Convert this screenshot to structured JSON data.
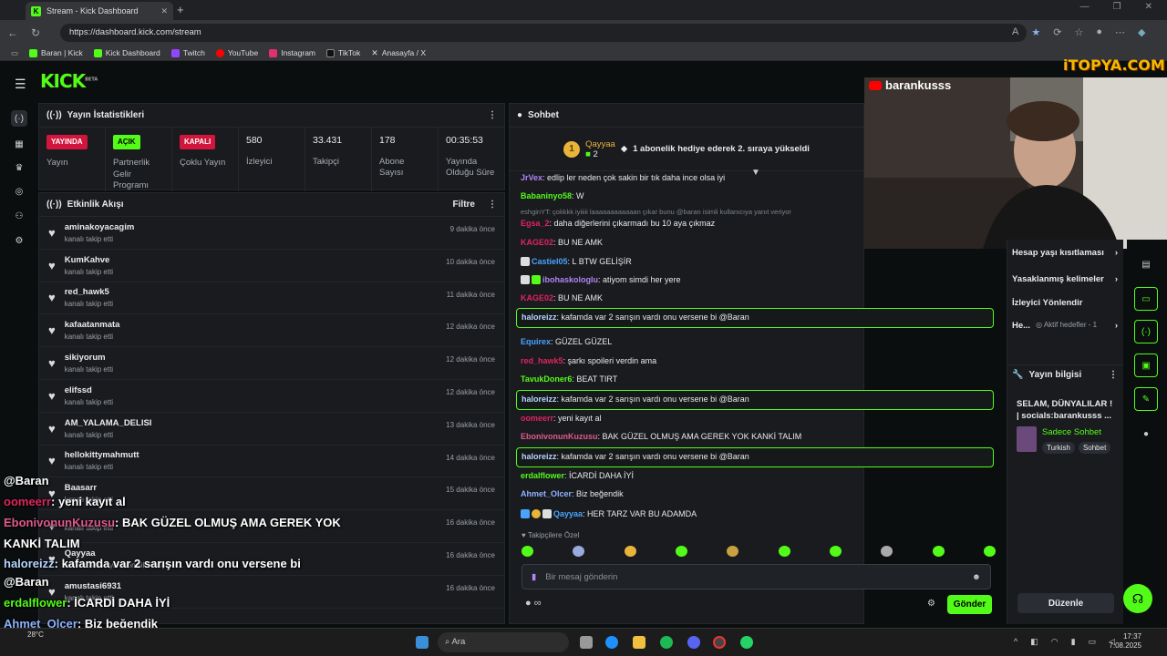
{
  "browser": {
    "tab_title": "Stream - Kick Dashboard",
    "url": "https://dashboard.kick.com/stream",
    "bookmarks": [
      "Baran | Kick",
      "Kick Dashboard",
      "Twitch",
      "YouTube",
      "Instagram",
      "TikTok",
      "Anasayfa / X"
    ]
  },
  "brand": {
    "logo": "KICK",
    "beta": "BETA",
    "watermark": "iTOPYA.COM",
    "accent": "#53fc18"
  },
  "stats": {
    "title": "Yayın İstatistikleri",
    "items": [
      {
        "badge": "YAYINDA",
        "label": "Yayın"
      },
      {
        "badge": "AÇIK",
        "label": "Partnerlik Gelir Programı"
      },
      {
        "badge": "KAPALI",
        "label": "Çoklu Yayın"
      },
      {
        "value": "580",
        "label": "İzleyici"
      },
      {
        "value": "33.431",
        "label": "Takipçi"
      },
      {
        "value": "178",
        "label": "Abone Sayısı"
      },
      {
        "value": "00:35:53",
        "label": "Yayında Olduğu Süre"
      }
    ]
  },
  "activity": {
    "title": "Etkinlik Akışı",
    "filter": "Filtre",
    "items": [
      {
        "name": "aminakoyacagim",
        "sub": "kanalı takip etti",
        "time": "9 dakika önce"
      },
      {
        "name": "KumKahve",
        "sub": "kanalı takip etti",
        "time": "10 dakika önce"
      },
      {
        "name": "red_hawk5",
        "sub": "kanalı takip etti",
        "time": "11 dakika önce"
      },
      {
        "name": "kafaatanmata",
        "sub": "kanalı takip etti",
        "time": "12 dakika önce"
      },
      {
        "name": "sikiyorum",
        "sub": "kanalı takip etti",
        "time": "12 dakika önce"
      },
      {
        "name": "elifssd",
        "sub": "kanalı takip etti",
        "time": "12 dakika önce"
      },
      {
        "name": "AM_YALAMA_DELISI",
        "sub": "kanalı takip etti",
        "time": "13 dakika önce"
      },
      {
        "name": "hellokittymahmutt",
        "sub": "kanalı takip etti",
        "time": "14 dakika önce"
      },
      {
        "name": "Baasarr",
        "sub": "kanalı takip etti",
        "time": "15 dakika önce"
      },
      {
        "name": "",
        "sub": "kanalı takip etti",
        "time": "16 dakika önce"
      },
      {
        "name": "Qayyaa",
        "sub": "isimli kullanıcıya abonelik hediye etti.",
        "time": "16 dakika önce"
      },
      {
        "name": "amustasi6931",
        "sub": "kanalı takip etti",
        "time": "16 dakika önce"
      }
    ]
  },
  "chat": {
    "title": "Sohbet",
    "pinned": {
      "user": "Qayyaa",
      "count": "2",
      "text": "1 abonelik hediye ederek 2. sıraya yükseldi"
    },
    "messages": [
      {
        "user": "JrVex",
        "color": "#b085f5",
        "text": "edlip ler neden çok sakin bir tık daha ince olsa iyi"
      },
      {
        "user": "Babaninyo58",
        "color": "#53fc18",
        "text": "W"
      },
      {
        "reply": "eshginYT: çokkkk iyiiiii laaaaaaaaaaaan çıkar bunu @baran isimli kullanıcıya yanıt veriyor",
        "user": "Egsa_2",
        "color": "#e0245e",
        "text": "daha diğerlerini çıkarmadı bu 10 aya çıkmaz"
      },
      {
        "user": "KAGE02",
        "color": "#e0245e",
        "text": "BU NE AMK"
      },
      {
        "user": "Castiel05",
        "color": "#4aa3ff",
        "text": "L BTW GELİŞİR"
      },
      {
        "user": "ibohaskologlu",
        "color": "#b085f5",
        "text": "atiyom simdi her yere"
      },
      {
        "user": "KAGE02",
        "color": "#e0245e",
        "text": "BU NE AMK"
      },
      {
        "user": "haloreizz",
        "color": "#b8d4ff",
        "text": "kafamda var 2 sarışın vardı onu versene bi @Baran",
        "highlight": true
      },
      {
        "user": "Equirex",
        "color": "#4aa3ff",
        "text": "GÜZEL GÜZEL"
      },
      {
        "user": "red_hawk5",
        "color": "#e0245e",
        "text": "şarkı spoileri verdin ama"
      },
      {
        "user": "TavukDoner6",
        "color": "#53fc18",
        "text": "BEAT TIRT"
      },
      {
        "user": "haloreizz",
        "color": "#b8d4ff",
        "text": "kafamda var 2 sarışın vardı onu versene bi @Baran",
        "highlight": true
      },
      {
        "user": "oomeerr",
        "color": "#e0245e",
        "text": "yeni kayıt al"
      },
      {
        "user": "EbonivonunKuzusu",
        "color": "#e05a8a",
        "text": "BAK GÜZEL OLMUŞ AMA GEREK YOK KANKİ TALIM"
      },
      {
        "user": "haloreizz",
        "color": "#b8d4ff",
        "text": "kafamda var 2 sarışın vardı onu versene bi @Baran",
        "highlight": true
      },
      {
        "user": "erdalflower",
        "color": "#53fc18",
        "text": "İCARDİ DAHA İYİ"
      },
      {
        "user": "Ahmet_Olcer",
        "color": "#8fb3ff",
        "text": "Biz beğendik"
      },
      {
        "user": "Qayyaa",
        "color": "#4aa3ff",
        "text": "HER TARZ VAR BU ADAMDA"
      }
    ],
    "followers_only": "Takipçilere Özel",
    "input_placeholder": "Bir mesaj gönderin",
    "send": "Gönder"
  },
  "camera": {
    "channel": "barankusss"
  },
  "settings": {
    "items": [
      "Hesap yaşı kısıtlaması",
      "Yasaklanmış kelimeler",
      "İzleyici Yönlendir"
    ],
    "goal_label": "He...",
    "goal_value": "Aktif hedefler - 1"
  },
  "stream_info": {
    "title": "Yayın bilgisi",
    "text": "SELAM, DÜNYALILAR ! | socials:barankusss ...",
    "category": "Sadece Sohbet",
    "tags": [
      "Turkish",
      "Sohbet"
    ],
    "edit": "Düzenle"
  },
  "overlay": [
    {
      "user": "@Baran",
      "text": "",
      "ucolor": "#ffffff"
    },
    {
      "user": "oomeerr",
      "text": ": yeni kayıt al",
      "ucolor": "#e0245e"
    },
    {
      "user": "EbonivonunKuzusu",
      "text": ": BAK GÜZEL OLMUŞ AMA GEREK YOK",
      "ucolor": "#e05a8a"
    },
    {
      "user": "",
      "text": "KANKİ TALIM",
      "ucolor": "#ffffff"
    },
    {
      "user": "haloreizz",
      "text": ": kafamda var 2 sarışın vardı onu versene bi",
      "ucolor": "#b8d4ff"
    },
    {
      "user": "",
      "text": "@Baran",
      "ucolor": "#ffffff"
    },
    {
      "user": "erdalflower",
      "text": ": İCARDİ DAHA İYİ",
      "ucolor": "#53fc18"
    },
    {
      "user": "Ahmet_Olcer",
      "text": ": Biz beğendik",
      "ucolor": "#8fb3ff"
    },
    {
      "user": "Qayyaa",
      "text": ": HER TARZ VAR BU ADAMDA",
      "ucolor": "#4aa3ff"
    }
  ],
  "taskbar": {
    "weather": "28°C",
    "search": "Ara",
    "time": "17:37",
    "date": "7.08.2025"
  }
}
